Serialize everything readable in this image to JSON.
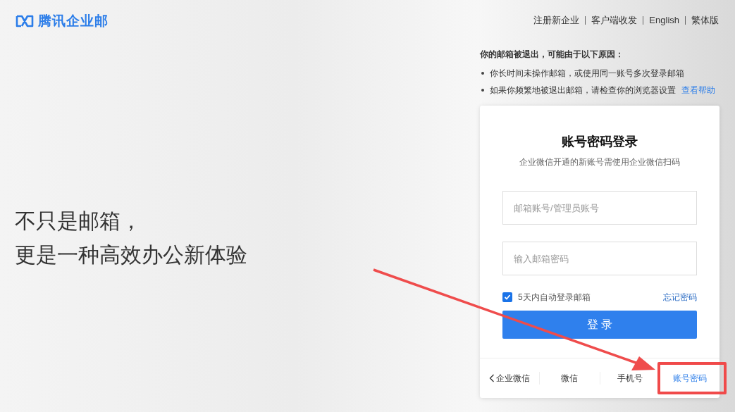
{
  "logo": {
    "text": "腾讯企业邮"
  },
  "top_links": [
    "注册新企业",
    "客户端收发",
    "English",
    "繁体版"
  ],
  "slogan": [
    "不只是邮箱，",
    "更是一种高效办公新体验"
  ],
  "notice": {
    "title": "你的邮箱被退出，可能由于以下原因：",
    "items": [
      {
        "text": "你长时间未操作邮箱，或使用同一账号多次登录邮箱"
      },
      {
        "text": "如果你频繁地被退出邮箱，请检查你的浏览器设置",
        "link": "查看帮助"
      }
    ]
  },
  "login": {
    "title": "账号密码登录",
    "subtitle": "企业微信开通的新账号需使用企业微信扫码",
    "account_field": {
      "placeholder": "邮箱账号/管理员账号"
    },
    "password_field": {
      "placeholder": "输入邮箱密码"
    },
    "remember": {
      "label": "5天内自动登录邮箱",
      "checked": true
    },
    "forgot_link": "忘记密码",
    "submit": "登 录"
  },
  "tabs": [
    {
      "label": "企业微信",
      "kind": "back",
      "selected": false
    },
    {
      "label": "微信",
      "kind": "plain",
      "selected": false
    },
    {
      "label": "手机号",
      "kind": "plain",
      "selected": false
    },
    {
      "label": "账号密码",
      "kind": "plain",
      "selected": true
    }
  ]
}
